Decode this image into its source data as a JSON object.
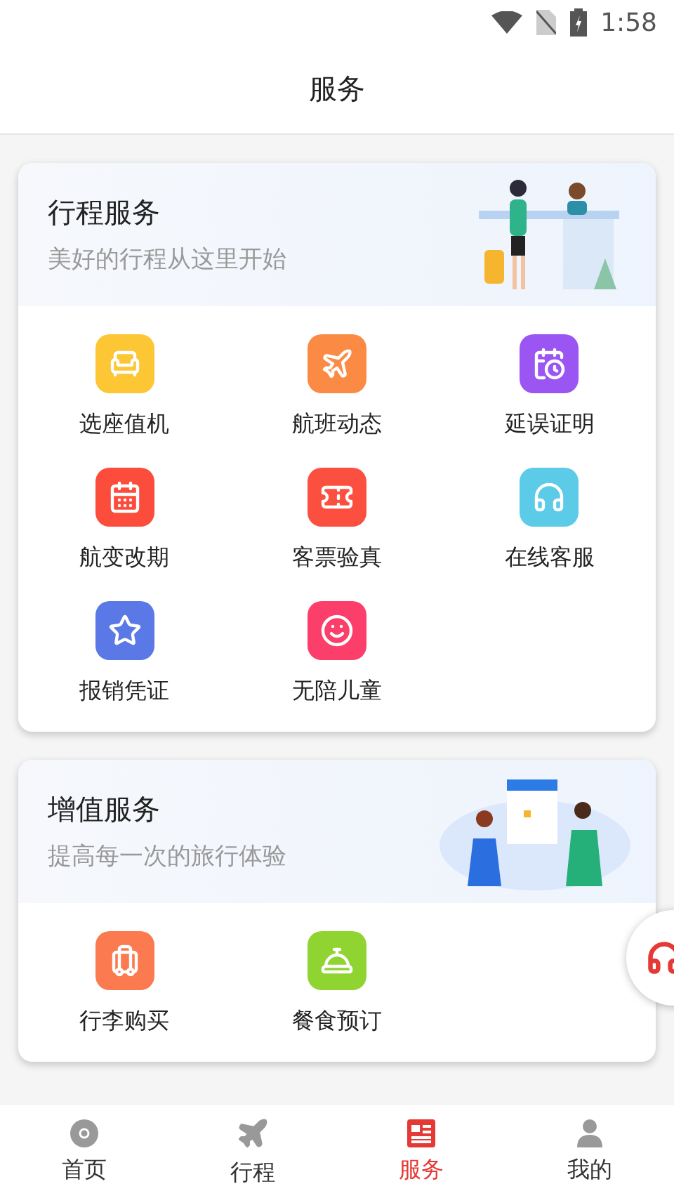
{
  "status_bar": {
    "time": "1:58"
  },
  "header": {
    "title": "服务"
  },
  "sections": [
    {
      "title": "行程服务",
      "subtitle": "美好的行程从这里开始",
      "kind": "counter",
      "items": [
        {
          "label": "选座值机",
          "kind": "seat",
          "color": "#fcc634"
        },
        {
          "label": "航班动态",
          "kind": "flight",
          "color": "#fb8a44"
        },
        {
          "label": "延误证明",
          "kind": "delay",
          "color": "#9a55f2"
        },
        {
          "label": "航变改期",
          "kind": "calendar",
          "color": "#fb4c3c"
        },
        {
          "label": "客票验真",
          "kind": "ticket",
          "color": "#fb5040"
        },
        {
          "label": "在线客服",
          "kind": "support",
          "color": "#5ccbe8"
        },
        {
          "label": "报销凭证",
          "kind": "receipt",
          "color": "#5a78e6"
        },
        {
          "label": "无陪儿童",
          "kind": "child",
          "color": "#fb3f6a"
        }
      ]
    },
    {
      "title": "增值服务",
      "subtitle": "提高每一次的旅行体验",
      "kind": "meeting",
      "items": [
        {
          "label": "行李购买",
          "kind": "luggage",
          "color": "#fb7a50"
        },
        {
          "label": "餐食预订",
          "kind": "meal",
          "color": "#8fd431"
        }
      ]
    }
  ],
  "nav": [
    {
      "label": "首页",
      "kind": "home",
      "selected": false
    },
    {
      "label": "行程",
      "kind": "trip",
      "selected": false
    },
    {
      "label": "服务",
      "kind": "service",
      "selected": true
    },
    {
      "label": "我的",
      "kind": "me",
      "selected": false
    }
  ]
}
